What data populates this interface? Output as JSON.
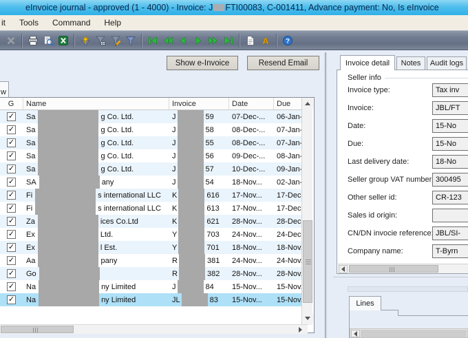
{
  "titlebar": {
    "title_part1": "eInvoice journal - approved (1 - 4000) - Invoice: J",
    "title_part2": "FTI00083, C-001411, Advance payment: No, Is eInvoice"
  },
  "menubar": {
    "items": [
      "it",
      "Tools",
      "Command",
      "Help"
    ]
  },
  "toolbar": {
    "icon_names": [
      "delete-icon",
      "print-icon",
      "print-preview-icon",
      "export-excel-icon",
      "filter-lightning-icon",
      "filter-grid-icon",
      "filter-pencil-icon",
      "filter-icon",
      "first-record-icon",
      "previous-page-icon",
      "previous-record-icon",
      "next-record-icon",
      "next-page-icon",
      "last-record-icon",
      "document-icon",
      "alert-icon",
      "help-icon"
    ]
  },
  "action_buttons": {
    "show_einvoice": "Show e-Invoice",
    "resend_email": "Resend Email"
  },
  "overview_tab_label": "w",
  "grid": {
    "columns": [
      "G",
      "Name",
      "Invoice",
      "Date",
      "Due"
    ],
    "rows": [
      {
        "checked": true,
        "name_prefix": "Sa",
        "name_suffix": "g Co. Ltd.",
        "invoice_prefix": "J",
        "invoice_suffix": "59",
        "date": "07-Dec-...",
        "due": "06-Jan-2",
        "selected": false
      },
      {
        "checked": true,
        "name_prefix": "Sa",
        "name_suffix": "g Co. Ltd.",
        "invoice_prefix": "J",
        "invoice_suffix": "58",
        "date": "08-Dec-...",
        "due": "07-Jan-2",
        "selected": false
      },
      {
        "checked": true,
        "name_prefix": "Sa",
        "name_suffix": "g Co. Ltd.",
        "invoice_prefix": "J",
        "invoice_suffix": "55",
        "date": "08-Dec-...",
        "due": "07-Jan-2",
        "selected": false
      },
      {
        "checked": true,
        "name_prefix": "Sa",
        "name_suffix": "g Co. Ltd.",
        "invoice_prefix": "J",
        "invoice_suffix": "56",
        "date": "09-Dec-...",
        "due": "08-Jan-2",
        "selected": false
      },
      {
        "checked": true,
        "name_prefix": "Sa",
        "name_suffix": "g Co. Ltd.",
        "invoice_prefix": "J",
        "invoice_suffix": "57",
        "date": "10-Dec-...",
        "due": "09-Jan-2",
        "selected": false
      },
      {
        "checked": true,
        "name_prefix": "SA",
        "name_suffix": "any",
        "invoice_prefix": "J",
        "invoice_suffix": "54",
        "date": "18-Nov...",
        "due": "02-Jan-2",
        "selected": false
      },
      {
        "checked": true,
        "name_prefix": "Fi",
        "name_suffix": "s international LLC",
        "invoice_prefix": "K",
        "invoice_suffix": "616",
        "date": "17-Nov...",
        "due": "17-Dec-",
        "selected": false
      },
      {
        "checked": true,
        "name_prefix": "Fi",
        "name_suffix": "s international LLC",
        "invoice_prefix": "K",
        "invoice_suffix": "613",
        "date": "17-Nov...",
        "due": "17-Dec-",
        "selected": false
      },
      {
        "checked": true,
        "name_prefix": "Za",
        "name_suffix": "ices Co.Ltd",
        "invoice_prefix": "K",
        "invoice_suffix": "621",
        "date": "28-Nov...",
        "due": "28-Dec-",
        "selected": false
      },
      {
        "checked": true,
        "name_prefix": "Ex",
        "name_suffix": "Ltd.",
        "invoice_prefix": "Y",
        "invoice_suffix": "703",
        "date": "24-Nov...",
        "due": "24-Dec-",
        "selected": false
      },
      {
        "checked": true,
        "name_prefix": "Ex",
        "name_suffix": "l Est.",
        "invoice_prefix": "Y",
        "invoice_suffix": "701",
        "date": "18-Nov...",
        "due": "18-Nov.",
        "selected": false
      },
      {
        "checked": true,
        "name_prefix": "Aa",
        "name_suffix": "pany",
        "invoice_prefix": "R",
        "invoice_suffix": "381",
        "date": "24-Nov...",
        "due": "24-Nov.",
        "selected": false
      },
      {
        "checked": true,
        "name_prefix": "Go",
        "name_suffix": "",
        "invoice_prefix": "R",
        "invoice_suffix": "382",
        "date": "28-Nov...",
        "due": "28-Nov.",
        "selected": false
      },
      {
        "checked": true,
        "name_prefix": "Na",
        "name_suffix": "ny Limited",
        "invoice_prefix": "J",
        "invoice_suffix": "84",
        "date": "15-Nov...",
        "due": "15-Nov.",
        "selected": false
      },
      {
        "checked": true,
        "name_prefix": "Na",
        "name_suffix": "ny Limited",
        "invoice_prefix": "JL",
        "invoice_suffix": "83",
        "date": "15-Nov...",
        "due": "15-Nov.",
        "selected": true
      }
    ]
  },
  "detail_panel": {
    "tabs": [
      "Invoice detail",
      "Notes",
      "Audit logs"
    ],
    "active_tab": "Invoice detail",
    "group_title": "Seller info",
    "fields": [
      {
        "label": "Invoice type:",
        "value": "Tax inv"
      },
      {
        "label": "Invoice:",
        "value": "JBL/FT"
      },
      {
        "label": "Date:",
        "value": "15-No"
      },
      {
        "label": "Due:",
        "value": "15-No"
      },
      {
        "label": "Last delivery date:",
        "value": "18-No"
      },
      {
        "label": "Seller group VAT number:",
        "value": "300495"
      },
      {
        "label": "Other seller id:",
        "value": "CR-123"
      },
      {
        "label": "Sales id origin:",
        "value": ""
      },
      {
        "label": "CN/DN invocie reference:",
        "value": "JBL/SI-"
      },
      {
        "label": "Company name:",
        "value": "T-Byrn"
      }
    ]
  },
  "lines_panel": {
    "tab_label": "Lines"
  },
  "colors": {
    "titlebar": "#3cb4e8",
    "toolbar": "#707b90",
    "selection": "#aee0f7",
    "alt_row": "#eaf4fc",
    "redaction": "#a8a8a8",
    "nav_green": "#2db83d",
    "help_blue": "#2f74c9",
    "alert_yellow": "#f0b000"
  }
}
